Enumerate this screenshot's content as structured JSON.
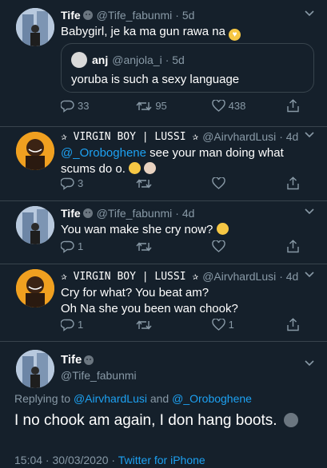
{
  "tweets": [
    {
      "name": "Tife",
      "handle": "@Tife_fabunmi",
      "time": "· 5d",
      "text": "Babygirl, je ka ma gun rawa na",
      "emoji": "😍",
      "quote": {
        "name": "anj",
        "handle": "@anjola_i",
        "time": "· 5d",
        "text": "yoruba is such a sexy language"
      },
      "replies": "33",
      "retweets": "95",
      "likes": "438"
    },
    {
      "name": "✰ VIRGIN BOY | LUSSI ✰",
      "handle": "@AirvhardLusi",
      "time": "· 4d",
      "mention": "@_Oroboghene",
      "text": "see your man doing what scums do o.",
      "emoji": "😁🤦🏻‍♂️",
      "replies": "3",
      "retweets": "",
      "likes": ""
    },
    {
      "name": "Tife",
      "handle": "@Tife_fabunmi",
      "time": "· 4d",
      "text": "You wan make she cry now?",
      "emoji": "😂",
      "replies": "1",
      "retweets": "",
      "likes": ""
    },
    {
      "name": "✰ VIRGIN BOY | LUSSI ✰",
      "handle": "@AirvhardLusi",
      "time": "· 4d",
      "line1": "Cry for what? You beat am?",
      "line2": "Oh Na she you been wan chook?",
      "replies": "1",
      "retweets": "",
      "likes": "1"
    }
  ],
  "main": {
    "name": "Tife",
    "handle": "@Tife_fabunmi",
    "replying_prefix": "Replying to",
    "replying_to_1": "@AirvhardLusi",
    "replying_and": "and",
    "replying_to_2": "@_Oroboghene",
    "text": "I no chook am again, I don hang boots.",
    "timestamp": "15:04 · 30/03/2020 ·",
    "source": "Twitter for iPhone"
  },
  "colors": {
    "background": "#15202b",
    "muted": "#8899a6",
    "link": "#1da1f2",
    "border": "#38444d"
  },
  "icons": [
    "reply-icon",
    "retweet-icon",
    "like-icon",
    "share-icon",
    "chevron-down-icon",
    "verified-style-badge"
  ]
}
